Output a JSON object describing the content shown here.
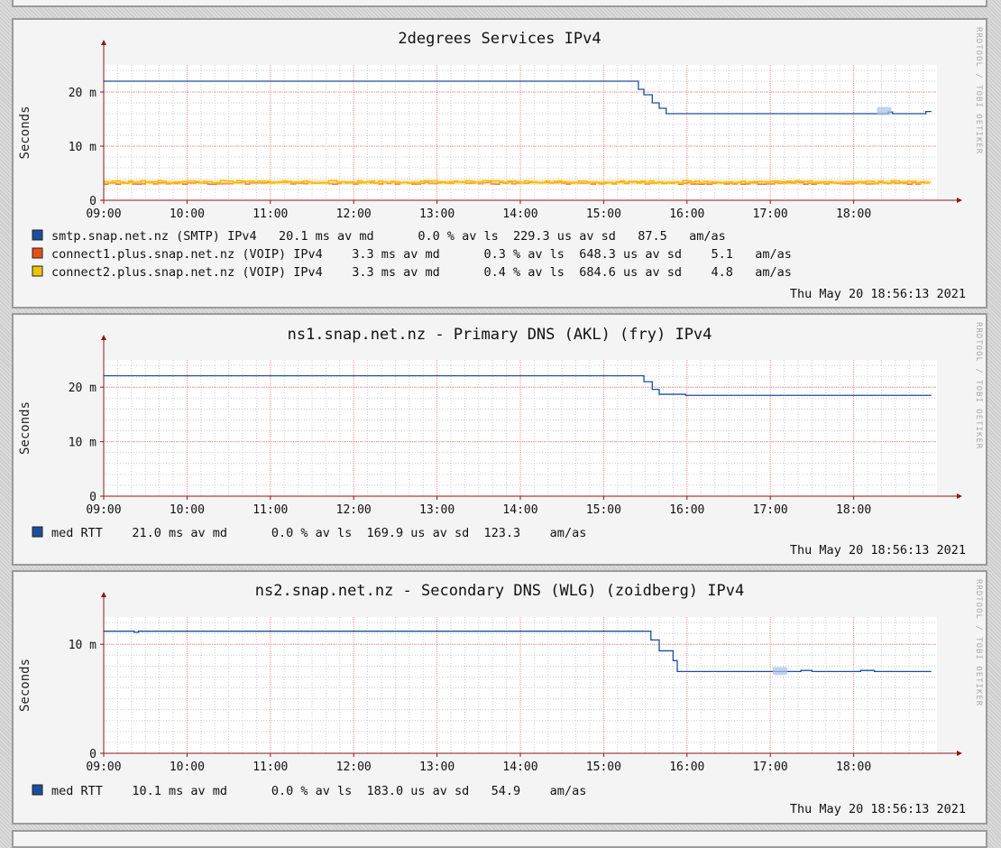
{
  "watermark": "RRDTOOL / TOBI OETIKER",
  "time_ticks": [
    "09:00",
    "10:00",
    "11:00",
    "12:00",
    "13:00",
    "14:00",
    "15:00",
    "16:00",
    "17:00",
    "18:00"
  ],
  "colors": {
    "grid_major": "#f08a8a",
    "grid_minor": "#cccccc",
    "axis": "#8b1a1a",
    "smtp": "#1a4f9c",
    "voip1": "#e8501a",
    "voip2": "#f2c400",
    "jitter_smtp": "#a8c0e6",
    "jitter_voip": "#ffd98a"
  },
  "chart_data": [
    {
      "type": "line",
      "title": "2degrees Services IPv4",
      "ylabel": "Seconds",
      "xlabel": "",
      "x_range": [
        "09:00",
        "18:56"
      ],
      "ylim": [
        0,
        0.025
      ],
      "y_ticks": [
        {
          "value": 0,
          "label": "0"
        },
        {
          "value": 0.01,
          "label": "10 m"
        },
        {
          "value": 0.02,
          "label": "20 m"
        }
      ],
      "grid": true,
      "legend_placement": "bottom",
      "series": [
        {
          "name": "smtp.snap.net.nz (SMTP) IPv4",
          "color": "#1a4f9c",
          "noise": 0,
          "points": [
            [
              "09:00",
              0.022
            ],
            [
              "15:20",
              0.022
            ],
            [
              "15:25",
              0.0205
            ],
            [
              "15:29",
              0.0195
            ],
            [
              "15:35",
              0.018
            ],
            [
              "15:40",
              0.017
            ],
            [
              "15:45",
              0.016
            ],
            [
              "17:45",
              0.016
            ],
            [
              "18:25",
              0.0163
            ],
            [
              "18:28",
              0.016
            ],
            [
              "18:50",
              0.016
            ],
            [
              "18:52",
              0.0164
            ],
            [
              "18:56",
              0.0164
            ]
          ]
        },
        {
          "name": "connect1.plus.snap.net.nz (VOIP) IPv4",
          "color": "#e8501a",
          "noise": 0.0002,
          "points": [
            [
              "09:00",
              0.0032
            ],
            [
              "18:56",
              0.0032
            ]
          ]
        },
        {
          "name": "connect2.plus.snap.net.nz (VOIP) IPv4",
          "color": "#f2c400",
          "noise": 0.00025,
          "points": [
            [
              "09:00",
              0.0034
            ],
            [
              "18:56",
              0.0034
            ]
          ]
        }
      ],
      "legend_lines": [
        {
          "text": "smtp.snap.net.nz (SMTP) IPv4   20.1 ms av md      0.0 % av ls  229.3 us av sd   87.5   am/as",
          "color": "#1a4f9c"
        },
        {
          "text": "connect1.plus.snap.net.nz (VOIP) IPv4    3.3 ms av md      0.3 % av ls  648.3 us av sd    5.1   am/as",
          "color": "#e8501a"
        },
        {
          "text": "connect2.plus.snap.net.nz (VOIP) IPv4    3.3 ms av md      0.4 % av ls  684.6 us av sd    4.8   am/as",
          "color": "#f2c400"
        }
      ],
      "timestamp": "Thu May 20 18:56:13 2021"
    },
    {
      "type": "line",
      "title": "ns1.snap.net.nz - Primary DNS (AKL) (fry) IPv4",
      "ylabel": "Seconds",
      "xlabel": "",
      "x_range": [
        "09:00",
        "18:56"
      ],
      "ylim": [
        0,
        0.025
      ],
      "y_ticks": [
        {
          "value": 0,
          "label": "0"
        },
        {
          "value": 0.01,
          "label": "10 m"
        },
        {
          "value": 0.02,
          "label": "20 m"
        }
      ],
      "grid": true,
      "legend_placement": "bottom",
      "series": [
        {
          "name": "med RTT",
          "color": "#1a4f9c",
          "noise": 0,
          "points": [
            [
              "09:00",
              0.0221
            ],
            [
              "15:25",
              0.0221
            ],
            [
              "15:29",
              0.021
            ],
            [
              "15:35",
              0.0196
            ],
            [
              "15:40",
              0.0187
            ],
            [
              "15:55",
              0.0187
            ],
            [
              "15:59",
              0.0185
            ],
            [
              "18:56",
              0.0185
            ]
          ]
        }
      ],
      "legend_lines": [
        {
          "text": "med RTT    21.0 ms av md      0.0 % av ls  169.9 us av sd  123.3    am/as",
          "color": "#1a4f9c"
        }
      ],
      "timestamp": "Thu May 20 18:56:13 2021"
    },
    {
      "type": "line",
      "title": "ns2.snap.net.nz - Secondary DNS (WLG) (zoidberg) IPv4",
      "ylabel": "Seconds",
      "xlabel": "",
      "x_range": [
        "09:00",
        "18:56"
      ],
      "ylim": [
        0,
        0.0125
      ],
      "y_ticks": [
        {
          "value": 0,
          "label": "0"
        },
        {
          "value": 0.01,
          "label": "10 m"
        }
      ],
      "grid": true,
      "legend_placement": "bottom",
      "series": [
        {
          "name": "med RTT",
          "color": "#1a4f9c",
          "noise": 0,
          "points": [
            [
              "09:00",
              0.0112
            ],
            [
              "09:20",
              0.0112
            ],
            [
              "09:22",
              0.0111
            ],
            [
              "09:25",
              0.0112
            ],
            [
              "15:30",
              0.0112
            ],
            [
              "15:34",
              0.0104
            ],
            [
              "15:40",
              0.0094
            ],
            [
              "15:50",
              0.0085
            ],
            [
              "15:53",
              0.0075
            ],
            [
              "17:20",
              0.0075
            ],
            [
              "17:22",
              0.0076
            ],
            [
              "17:30",
              0.0075
            ],
            [
              "18:00",
              0.0075
            ],
            [
              "18:05",
              0.0076
            ],
            [
              "18:15",
              0.0075
            ],
            [
              "18:56",
              0.0075
            ]
          ]
        }
      ],
      "legend_lines": [
        {
          "text": "med RTT    10.1 ms av md      0.0 % av ls  183.0 us av sd   54.9    am/as",
          "color": "#1a4f9c"
        }
      ],
      "timestamp": "Thu May 20 18:56:13 2021"
    }
  ]
}
